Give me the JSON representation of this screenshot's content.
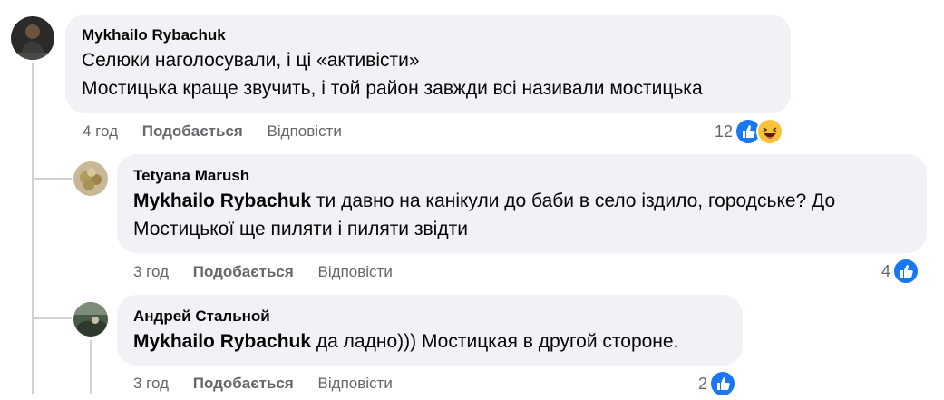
{
  "comments": [
    {
      "author": "Mykhailo Rybachuk",
      "lines": [
        "Селюки наголосували, і ці «активісти»",
        "Мостицька краще звучить, і той район завжди всі називали мостицька"
      ],
      "time": "4 год",
      "like_label": "Подобається",
      "reply_label": "Відповісти",
      "reaction_count": "12",
      "reactions": [
        "like-icon",
        "haha-icon"
      ]
    },
    {
      "author": "Tetyana Marush",
      "mention": "Mykhailo Rybachuk",
      "text_line1": " ти давно на канікули до баби в село іздило, городське? До",
      "text_line2": "Мостицької ще пиляти і пиляти звідти",
      "time": "3 год",
      "like_label": "Подобається",
      "reply_label": "Відповісти",
      "reaction_count": "4",
      "reactions": [
        "like-icon"
      ]
    },
    {
      "author": "Андрей Стальной",
      "mention": "Mykhailo Rybachuk",
      "text_line1": " да ладно))) Мостицкая в другой стороне.",
      "time": "3 год",
      "like_label": "Подобається",
      "reply_label": "Відповісти",
      "reaction_count": "2",
      "reactions": [
        "like-icon"
      ]
    }
  ],
  "colors": {
    "bubble": "#f0f2f5",
    "meta_text": "#65676b",
    "like_blue": "#1877f2",
    "haha_yellow": "#f7c23a",
    "thread_line": "#d0d2d6"
  }
}
